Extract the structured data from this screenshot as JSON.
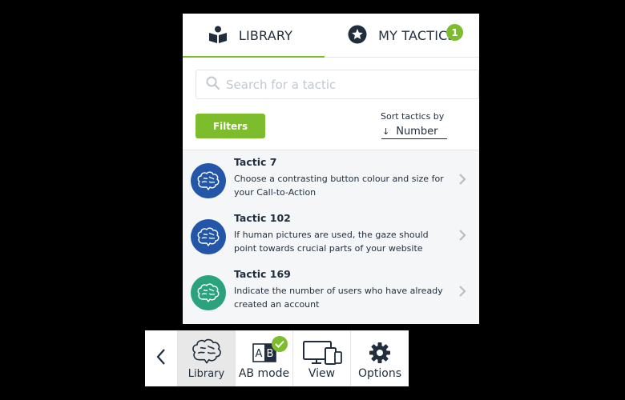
{
  "tabs": {
    "library": {
      "label": "LIBRARY",
      "icon": "book-reader-icon"
    },
    "my_tactics": {
      "label": "MY TACTICS",
      "icon": "star-icon",
      "badge": "1"
    }
  },
  "search": {
    "placeholder": "Search for a tactic",
    "value": ""
  },
  "filters": {
    "label": "Filters"
  },
  "sort": {
    "label": "Sort tactics by",
    "value": "Number",
    "arrow": "↓"
  },
  "tactics": [
    {
      "title": "Tactic 7",
      "desc": "Choose a contrasting button colour and size for your Call-to-Action",
      "color": "blue",
      "icon": "brain-icon"
    },
    {
      "title": "Tactic 102",
      "desc": "If human pictures are used, the gaze should point towards crucial parts of your website",
      "color": "blue",
      "icon": "brain-icon"
    },
    {
      "title": "Tactic 169",
      "desc": "Indicate the number of users who have already created an account",
      "color": "green",
      "icon": "brain-icon"
    }
  ],
  "toolbar": {
    "back_icon": "chevron-left-icon",
    "library": {
      "label": "Library",
      "icon": "brain-outline-icon",
      "active": true
    },
    "ab_mode": {
      "label": "AB mode",
      "icon": "ab-icon",
      "checked": true
    },
    "view": {
      "label": "View",
      "icon": "devices-icon"
    },
    "options": {
      "label": "Options",
      "icon": "gear-icon"
    }
  },
  "colors": {
    "accent": "#7cbc2d",
    "blue": "#2356a8",
    "green": "#2aa37c",
    "text": "#1f2d3d"
  }
}
